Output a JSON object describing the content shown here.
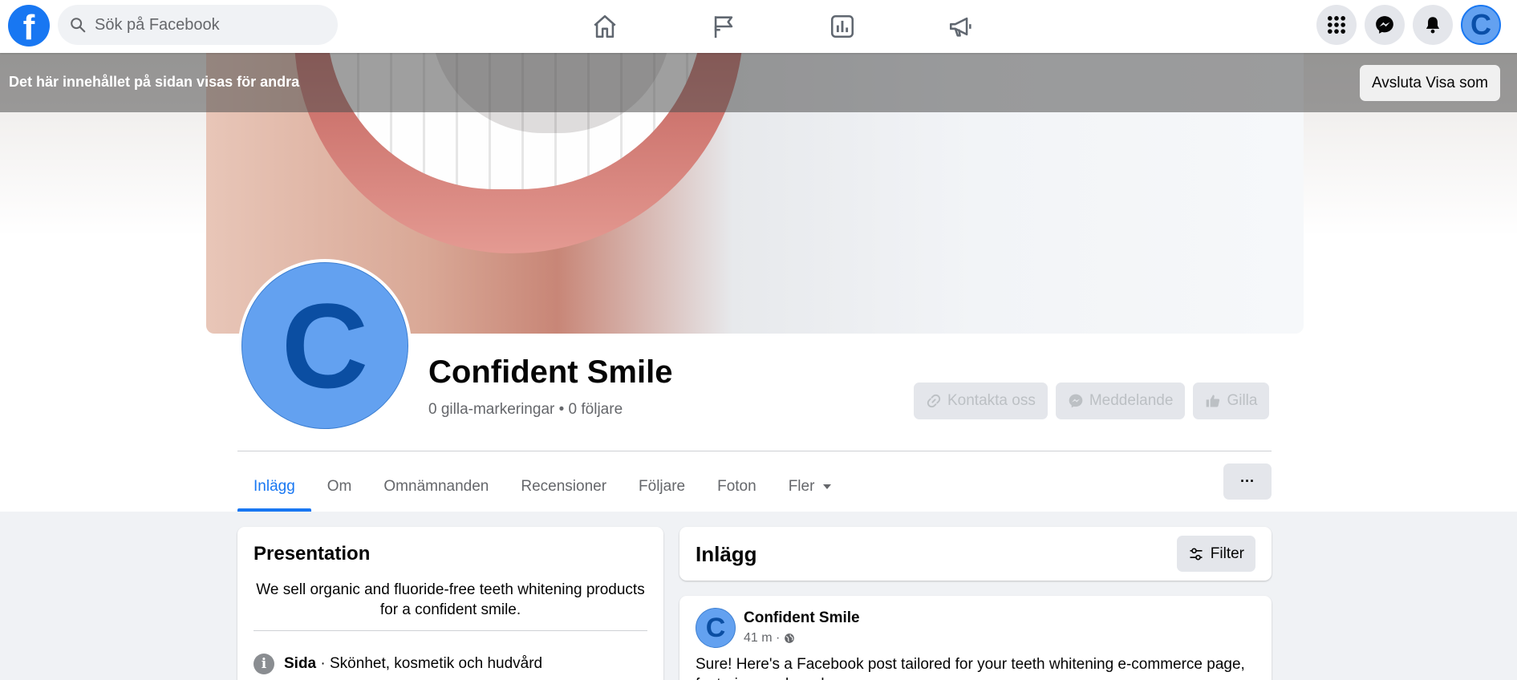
{
  "topnav": {
    "search_placeholder": "Sök på Facebook",
    "nav_icons": [
      "home-icon",
      "flag-icon",
      "insights-icon",
      "megaphone-icon"
    ],
    "right_icons": [
      "menu-grid-icon",
      "messenger-icon",
      "notifications-icon"
    ],
    "avatar_letter": "C"
  },
  "viewbar": {
    "text": "Det här innehållet på sidan visas för andra",
    "exit_label": "Avsluta Visa som"
  },
  "profile": {
    "avatar_letter": "C",
    "name": "Confident Smile",
    "stats": "0 gilla-markeringar • 0 följare",
    "actions": [
      {
        "label": "Kontakta oss",
        "icon": "link-icon"
      },
      {
        "label": "Meddelande",
        "icon": "messenger-icon"
      },
      {
        "label": "Gilla",
        "icon": "thumbs-up-icon"
      }
    ]
  },
  "tabs": [
    "Inlägg",
    "Om",
    "Omnämnanden",
    "Recensioner",
    "Följare",
    "Foton",
    "Fler"
  ],
  "more_label": "···",
  "intro": {
    "title": "Presentation",
    "description": "We sell organic and fluoride-free teeth whitening products for a confident smile.",
    "category_label": "Sida",
    "category_value": " · Skönhet, kosmetik och hudvård"
  },
  "posts": {
    "title": "Inlägg",
    "filter_label": "Filter",
    "post": {
      "avatar_letter": "C",
      "author": "Confident Smile",
      "time": "41 m ·",
      "text": "Sure! Here's a Facebook post tailored for your teeth whitening e-commerce page, featuring our brand ..."
    }
  },
  "colors": {
    "brand": "#1877f2",
    "avatar_fill": "#63a1f0",
    "avatar_letter": "#0b4ea2"
  }
}
